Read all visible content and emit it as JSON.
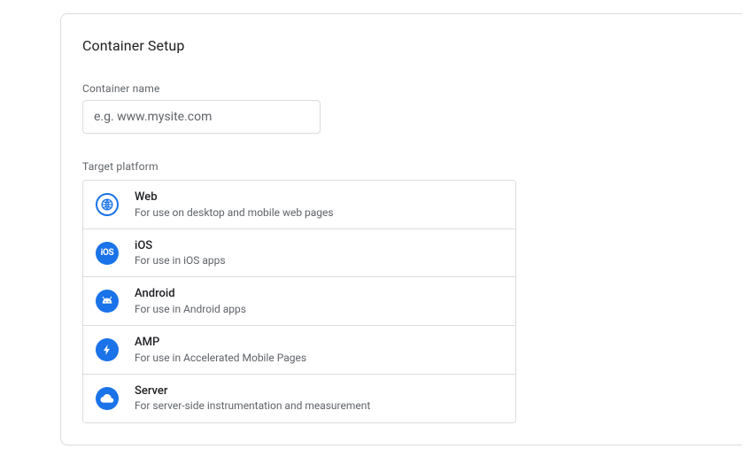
{
  "title": "Container Setup",
  "container_name": {
    "label": "Container name",
    "placeholder": "e.g. www.mysite.com",
    "value": ""
  },
  "target_platform": {
    "label": "Target platform",
    "options": [
      {
        "id": "web",
        "name": "Web",
        "desc": "For use on desktop and mobile web pages"
      },
      {
        "id": "ios",
        "name": "iOS",
        "desc": "For use in iOS apps"
      },
      {
        "id": "android",
        "name": "Android",
        "desc": "For use in Android apps"
      },
      {
        "id": "amp",
        "name": "AMP",
        "desc": "For use in Accelerated Mobile Pages"
      },
      {
        "id": "server",
        "name": "Server",
        "desc": "For server-side instrumentation and measurement"
      }
    ]
  }
}
